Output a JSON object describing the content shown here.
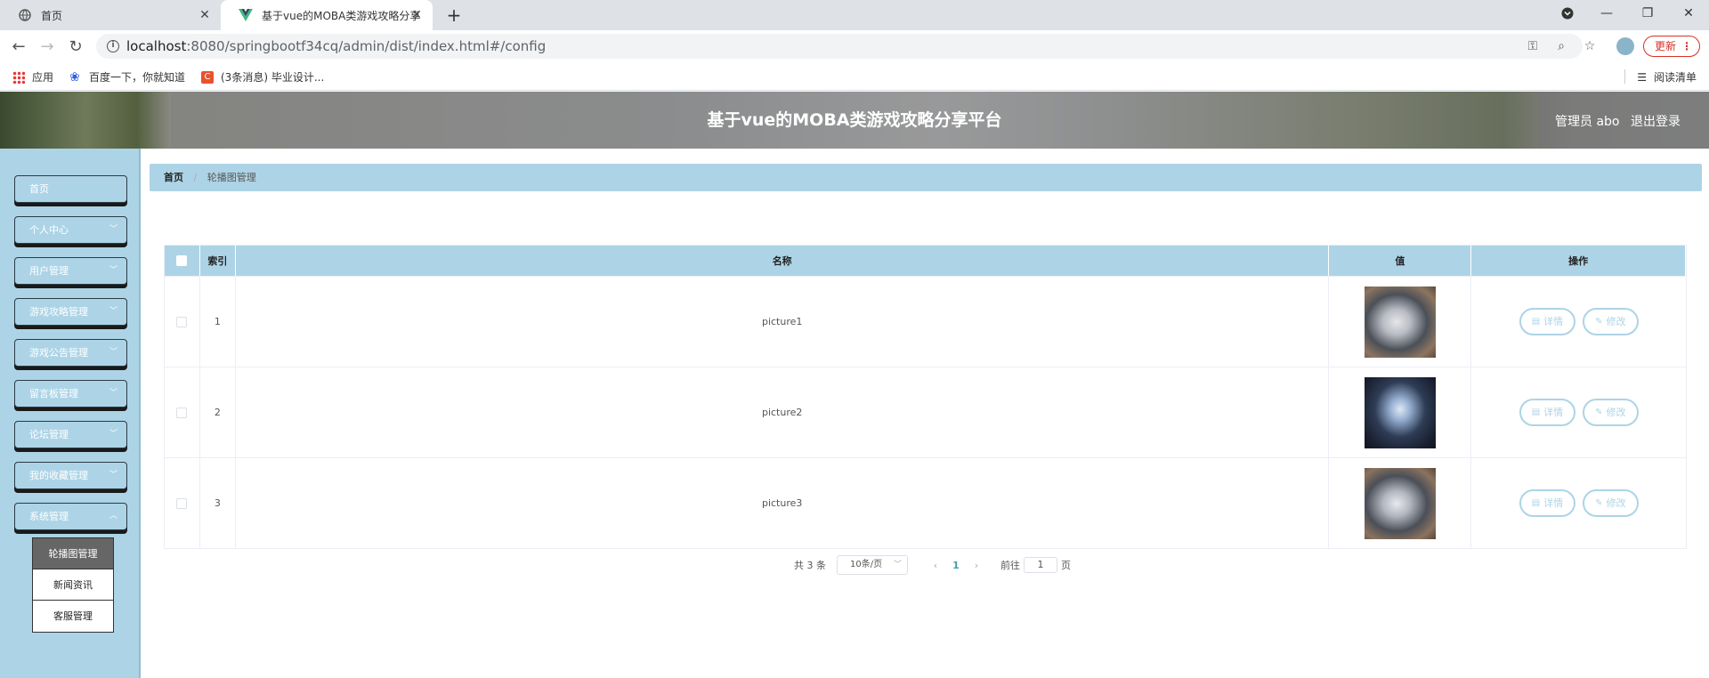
{
  "browser": {
    "tabs": [
      {
        "label": "首页"
      },
      {
        "label": "基于vue的MOBA类游戏攻略分享"
      }
    ],
    "url_host": "localhost",
    "url_path": ":8080/springbootf34cq/admin/dist/index.html#/config",
    "update_label": "更新",
    "bookmarks": [
      {
        "label": "应用"
      },
      {
        "label": "百度一下，你就知道"
      },
      {
        "label": "(3条消息) 毕业设计..."
      }
    ],
    "reading_list": "阅读清单"
  },
  "header": {
    "title": "基于vue的MOBA类游戏攻略分享平台",
    "user": "管理员 abo",
    "logout": "退出登录"
  },
  "sidebar": {
    "items": [
      {
        "label": "首页"
      },
      {
        "label": "个人中心"
      },
      {
        "label": "用户管理"
      },
      {
        "label": "游戏攻略管理"
      },
      {
        "label": "游戏公告管理"
      },
      {
        "label": "留言板管理"
      },
      {
        "label": "论坛管理"
      },
      {
        "label": "我的收藏管理"
      },
      {
        "label": "系统管理"
      }
    ],
    "submenu": [
      {
        "label": "轮播图管理"
      },
      {
        "label": "新闻资讯"
      },
      {
        "label": "客服管理"
      }
    ]
  },
  "breadcrumb": {
    "home": "首页",
    "separator": "/",
    "current": "轮播图管理"
  },
  "table": {
    "headers": {
      "index": "索引",
      "name": "名称",
      "value": "值",
      "actions": "操作"
    },
    "rows": [
      {
        "index": "1",
        "name": "picture1"
      },
      {
        "index": "2",
        "name": "picture2"
      },
      {
        "index": "3",
        "name": "picture3"
      }
    ],
    "detail_label": "详情",
    "edit_label": "修改"
  },
  "pagination": {
    "total": "共 3 条",
    "page_size": "10条/页",
    "current_page": "1",
    "goto_prefix": "前往",
    "goto_value": "1",
    "goto_suffix": "页"
  },
  "colors": {
    "accent": "#add4e6",
    "active_submenu": "#666666"
  }
}
